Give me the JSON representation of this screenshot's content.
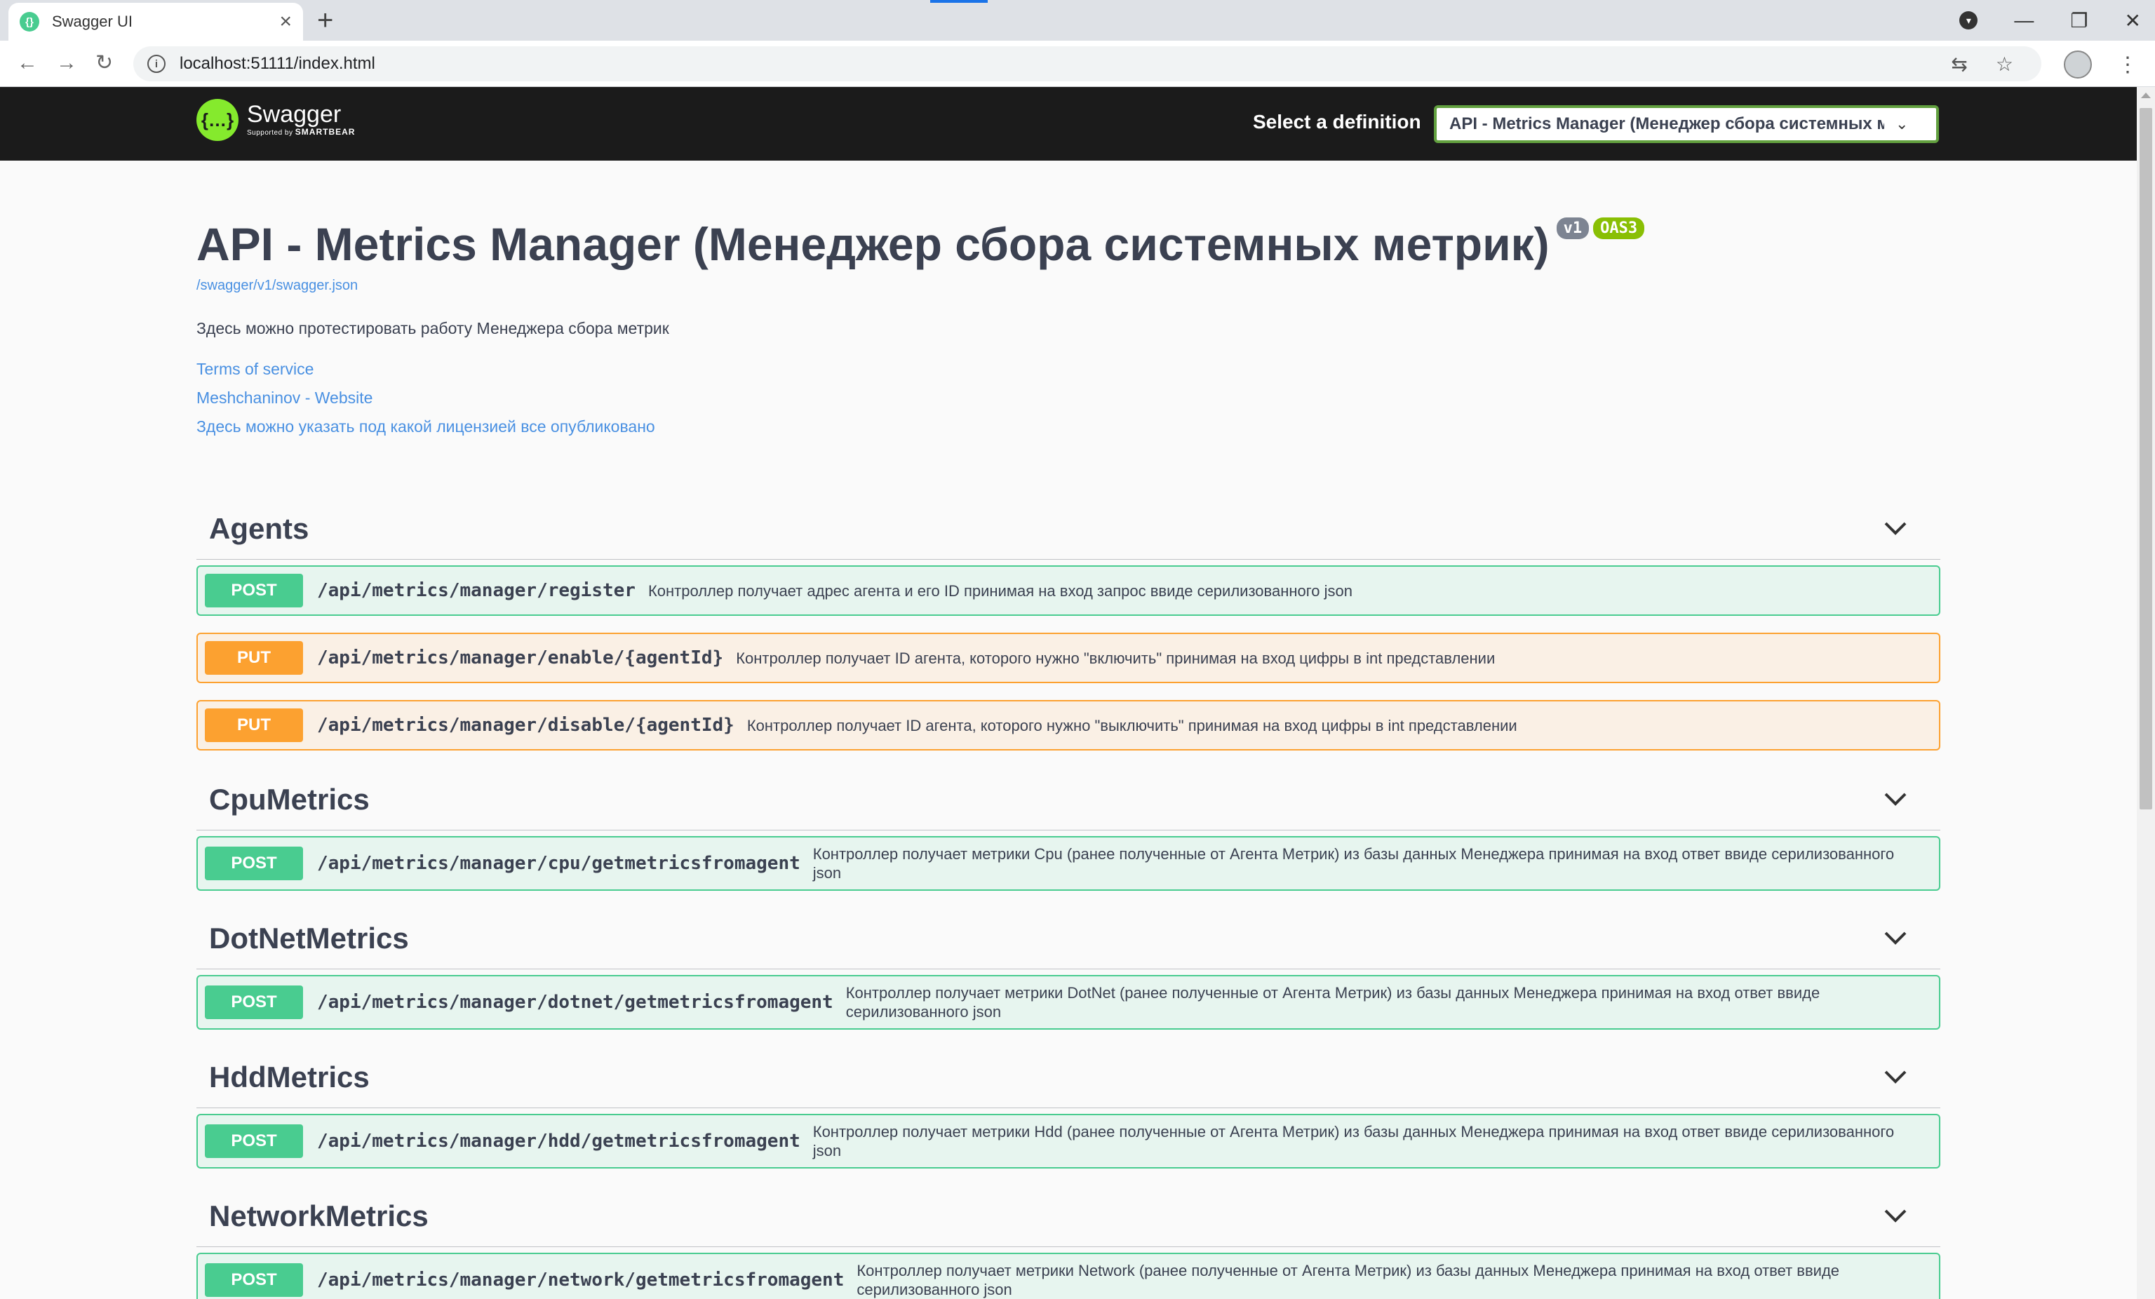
{
  "browser": {
    "tab_title": "Swagger UI",
    "url": "localhost:51111/index.html"
  },
  "topbar": {
    "logo_name": "Swagger",
    "logo_sub_prefix": "Supported by",
    "logo_sub_brand": "SMARTBEAR",
    "select_label": "Select a definition",
    "selected_definition": "API - Metrics Manager (Менеджер сбора системных метрик)"
  },
  "info": {
    "title": "API - Metrics Manager (Менеджер сбора системных метрик)",
    "version_badge": "v1",
    "oas_badge": "OAS3",
    "spec_url": "/swagger/v1/swagger.json",
    "description": "Здесь можно протестировать работу Менеджера сбора метрик",
    "terms": "Terms of service",
    "contact": "Meshchaninov - Website",
    "license": "Здесь можно указать под какой лицензией все опубликовано"
  },
  "tags": [
    {
      "name": "Agents",
      "operations": [
        {
          "method": "POST",
          "path": "/api/metrics/manager/register",
          "summary": "Контроллер получает адрес агента и его ID принимая на вход запрос ввиде серилизованного json"
        },
        {
          "method": "PUT",
          "path": "/api/metrics/manager/enable/{agentId}",
          "summary": "Контроллер получает ID агента, которого нужно \"включить\" принимая на вход цифры в int представлении"
        },
        {
          "method": "PUT",
          "path": "/api/metrics/manager/disable/{agentId}",
          "summary": "Контроллер получает ID агента, которого нужно \"выключить\" принимая на вход цифры в int представлении"
        }
      ]
    },
    {
      "name": "CpuMetrics",
      "operations": [
        {
          "method": "POST",
          "path": "/api/metrics/manager/cpu/getmetricsfromagent",
          "summary": "Контроллер получает метрики Cpu (ранее полученные от Агента Метрик) из базы данных Менеджера принимая на вход ответ ввиде серилизованного json"
        }
      ]
    },
    {
      "name": "DotNetMetrics",
      "operations": [
        {
          "method": "POST",
          "path": "/api/metrics/manager/dotnet/getmetricsfromagent",
          "summary": "Контроллер получает метрики DotNet (ранее полученные от Агента Метрик) из базы данных Менеджера принимая на вход ответ ввиде серилизованного json"
        }
      ]
    },
    {
      "name": "HddMetrics",
      "operations": [
        {
          "method": "POST",
          "path": "/api/metrics/manager/hdd/getmetricsfromagent",
          "summary": "Контроллер получает метрики Hdd (ранее полученные от Агента Метрик) из базы данных Менеджера принимая на вход ответ ввиде серилизованного json"
        }
      ]
    },
    {
      "name": "NetworkMetrics",
      "operations": [
        {
          "method": "POST",
          "path": "/api/metrics/manager/network/getmetricsfromagent",
          "summary": "Контроллер получает метрики Network (ранее полученные от Агента Метрик) из базы данных Менеджера принимая на вход ответ ввиде серилизованного json"
        }
      ]
    }
  ]
}
